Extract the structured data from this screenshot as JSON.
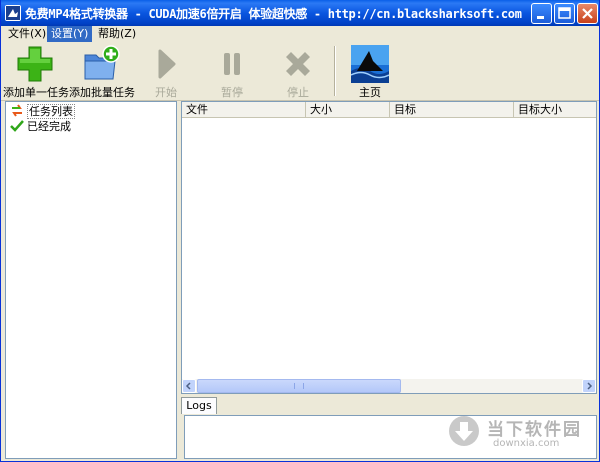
{
  "window": {
    "title": "免费MP4格式转换器 - CUDA加速6倍开启 体验超快感 - http://cn.blacksharksoft.com",
    "controls": [
      "minimize-icon",
      "maximize-icon",
      "close-icon"
    ]
  },
  "menu": {
    "items": [
      {
        "label": "文件(X)",
        "active": false
      },
      {
        "label": "设置(Y)",
        "active": true
      },
      {
        "label": "帮助(Z)",
        "active": false
      }
    ]
  },
  "toolbar": {
    "add_single": {
      "label": "添加单一任务",
      "icon": "green-plus-icon",
      "enabled": true
    },
    "add_batch": {
      "label": "添加批量任务",
      "icon": "folder-add-icon",
      "enabled": true
    },
    "start": {
      "label": "开始",
      "icon": "play-icon",
      "enabled": false
    },
    "pause": {
      "label": "暂停",
      "icon": "pause-icon",
      "enabled": false
    },
    "stop": {
      "label": "停止",
      "icon": "stop-x-icon",
      "enabled": false
    },
    "home": {
      "label": "主页",
      "icon": "shark-logo-icon",
      "enabled": true
    }
  },
  "tree": {
    "items": [
      {
        "label": "任务列表",
        "icon": "task-list-icon",
        "selected": true
      },
      {
        "label": "已经完成",
        "icon": "checkmark-icon",
        "selected": false
      }
    ]
  },
  "list": {
    "columns": [
      "文件",
      "大小",
      "目标",
      "目标大小"
    ],
    "rows": []
  },
  "logs": {
    "tab_label": "Logs"
  },
  "watermark": {
    "cn": "当下软件园",
    "en": "downxia.com"
  },
  "colors": {
    "titlebar": "#0a56e0",
    "menu_highlight": "#316ac5",
    "plus_green": "#3cb316",
    "disabled_gray": "#a9a99a"
  }
}
